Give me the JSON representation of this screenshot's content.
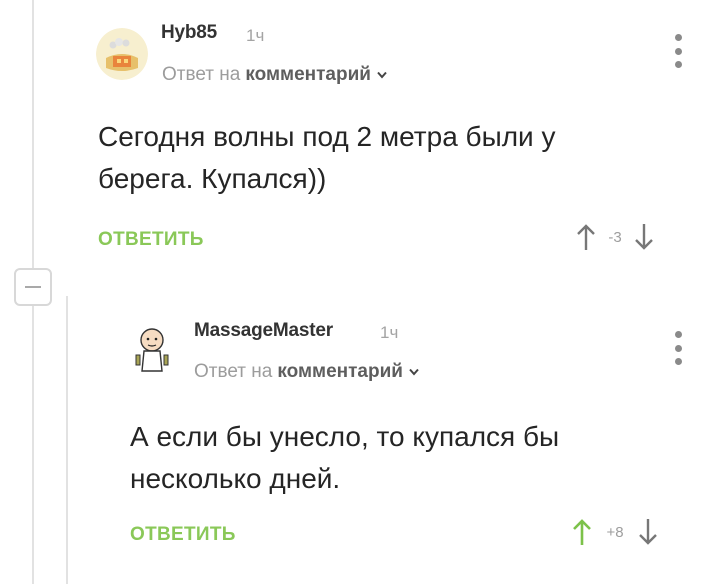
{
  "comments": [
    {
      "username": "Hyb85",
      "time": "1ч",
      "reply_prefix": "Ответ на",
      "reply_target": "комментарий",
      "text_lines": [
        "Сегодня волны под 2 метра были у",
        "берега. Купался))"
      ],
      "reply_label": "ОТВЕТИТЬ",
      "score": "-3",
      "upvoted": false
    },
    {
      "username": "MassageMaster",
      "time": "1ч",
      "reply_prefix": "Ответ на",
      "reply_target": "комментарий",
      "text_lines": [
        "А если бы унесло, то купался бы",
        "несколько дней."
      ],
      "reply_label": "ОТВЕТИТЬ",
      "score": "+8",
      "upvoted": true
    }
  ],
  "colors": {
    "accent": "#8ac858",
    "thread_line": "#e2e2e2",
    "muted": "#9c9c9c"
  },
  "icons": {
    "upvote": "arrow-up-icon",
    "downvote": "arrow-down-icon",
    "menu": "kebab-icon",
    "collapse": "minus-icon",
    "dropdown": "chevron-down-icon"
  }
}
